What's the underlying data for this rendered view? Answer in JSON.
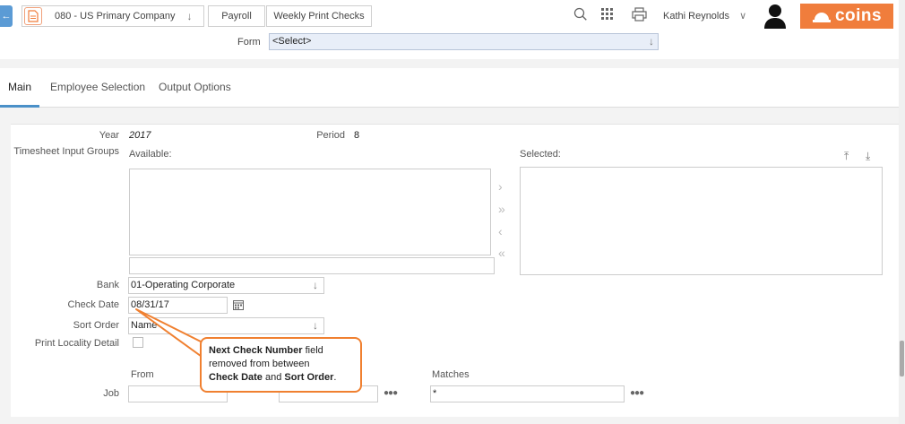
{
  "breadcrumb": {
    "company": "080 - US Primary Company",
    "module": "Payroll",
    "page": "Weekly Print Checks"
  },
  "user": {
    "name": "Kathi Reynolds"
  },
  "brand": {
    "logo_text": "coins",
    "accent": "#f07d3c"
  },
  "form": {
    "label": "Form",
    "value": "<Select>"
  },
  "tabs": [
    {
      "label": "Main"
    },
    {
      "label": "Employee Selection"
    },
    {
      "label": "Output Options"
    }
  ],
  "main": {
    "year_label": "Year",
    "year_value": "2017",
    "period_label": "Period",
    "period_value": "8",
    "tig_label": "Timesheet Input Groups",
    "available_label": "Available:",
    "selected_label": "Selected:",
    "bank_label": "Bank",
    "bank_value": "01-Operating Corporate",
    "check_date_label": "Check Date",
    "check_date_value": "08/31/17",
    "sort_order_label": "Sort Order",
    "sort_order_value": "Name",
    "print_locality_label": "Print Locality Detail",
    "from_label": "From",
    "matches_label": "Matches",
    "job_label": "Job",
    "job_matches_value": "*"
  },
  "callout": {
    "line1_bold": "Next Check Number",
    "line1_rest": " field",
    "line2": "removed from between",
    "line3_bold_a": "Check Date",
    "line3_mid": " and ",
    "line3_bold_b": "Sort Order",
    "line3_end": "."
  }
}
